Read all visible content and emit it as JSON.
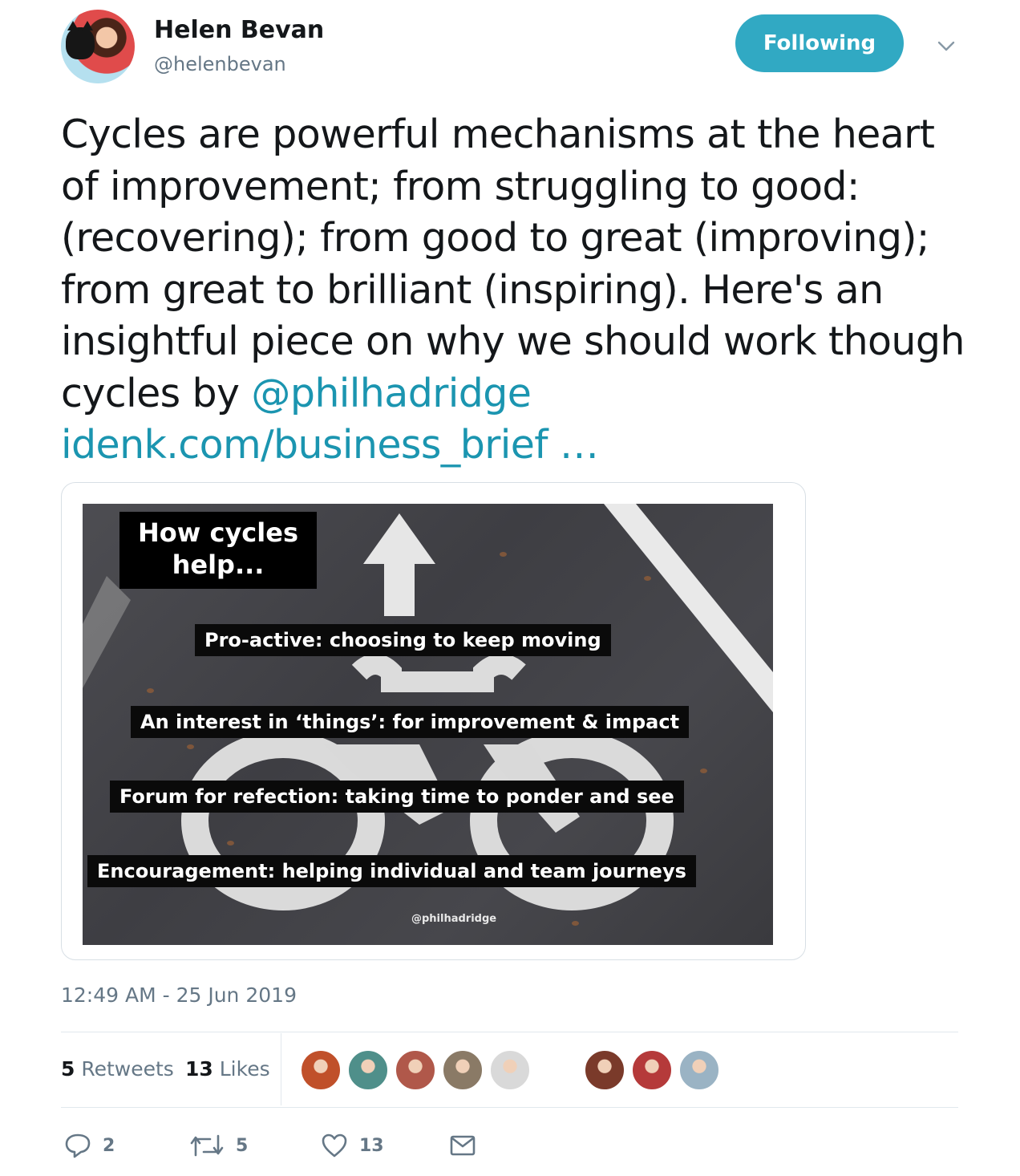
{
  "user": {
    "display_name": "Helen Bevan",
    "handle": "@helenbevan",
    "follow_label": "Following"
  },
  "tweet": {
    "text_part1": "Cycles are powerful mechanisms at the heart of improvement; from struggling to good: (recovering); from good to great (improving); from great to brilliant (inspiring). Here's an insightful piece on why we should work though cycles by ",
    "mention": "@philhadridge",
    "link": " idenk.com/business_brief …",
    "timestamp": "12:49 AM - 25 Jun 2019"
  },
  "media": {
    "title": "How cycles help...",
    "labels": [
      "Pro-active: choosing to keep moving",
      "An interest in ‘things’: for improvement & impact",
      "Forum for refection: taking time to ponder and see",
      "Encouragement: helping individual and team journeys"
    ],
    "credit": "@philhadridge"
  },
  "stats": {
    "retweets_count": "5",
    "retweets_label": "Retweets",
    "likes_count": "13",
    "likes_label": "Likes"
  },
  "likers": [
    {
      "name": "liker-1",
      "color": "#c0502a"
    },
    {
      "name": "liker-2",
      "color": "#4f8f8a"
    },
    {
      "name": "liker-3",
      "color": "#b0584a"
    },
    {
      "name": "liker-4",
      "color": "#8a7a66"
    },
    {
      "name": "liker-5",
      "color": "#d9d9d9"
    },
    {
      "name": "liker-6",
      "color": "#ffffff"
    },
    {
      "name": "liker-7",
      "color": "#7a3a2a"
    },
    {
      "name": "liker-8",
      "color": "#b53a3a"
    },
    {
      "name": "liker-9",
      "color": "#9ab3c4"
    }
  ],
  "actions": {
    "reply_count": "2",
    "retweet_count": "5",
    "like_count": "13"
  },
  "icons": {
    "caret": "chevron-down-icon",
    "reply": "reply-icon",
    "retweet": "retweet-icon",
    "like": "heart-icon",
    "dm": "envelope-icon"
  },
  "colors": {
    "accent": "#31a9c3",
    "link": "#1b95b0",
    "secondary_text": "#657786"
  }
}
